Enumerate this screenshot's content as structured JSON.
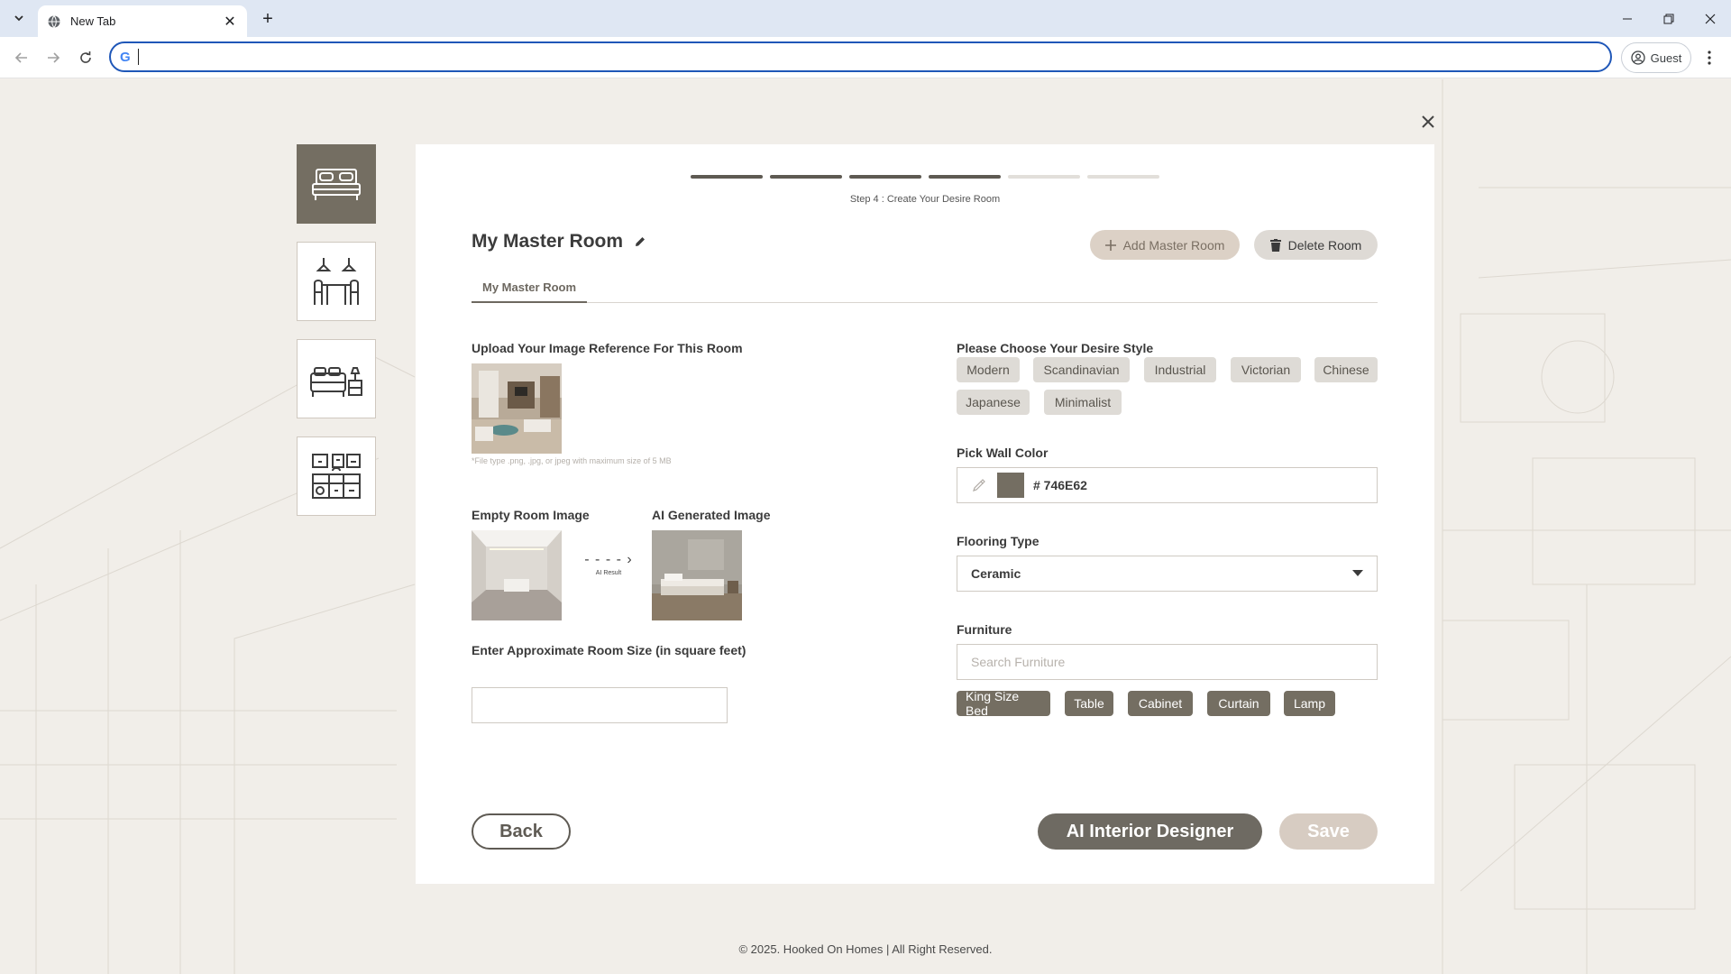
{
  "browser": {
    "tab_title": "New Tab",
    "omnibox_value": "",
    "profile_label": "Guest"
  },
  "progress": {
    "total_steps": 6,
    "completed_steps": 4,
    "step_label": "Step 4 : Create Your Desire Room"
  },
  "room": {
    "title": "My Master Room",
    "add_button": "Add Master Room",
    "delete_button": "Delete Room",
    "tabs": [
      "My Master Room"
    ]
  },
  "upload": {
    "label": "Upload Your Image Reference For This Room",
    "hint": "*File type .png, .jpg, or jpeg with maximum size of 5 MB"
  },
  "images": {
    "empty_label": "Empty Room Image",
    "ai_label": "AI Generated Image",
    "arrow_caption": "AI Result"
  },
  "size": {
    "label": "Enter Approximate Room Size (in square feet)",
    "value": ""
  },
  "style": {
    "label": "Please Choose Your Desire Style",
    "options": [
      "Modern",
      "Scandinavian",
      "Industrial",
      "Victorian",
      "Chinese",
      "Japanese",
      "Minimalist"
    ]
  },
  "wall_color": {
    "label": "Pick Wall Color",
    "hex_text": "# 746E62",
    "swatch": "#746e62"
  },
  "flooring": {
    "label": "Flooring Type",
    "selected": "Ceramic"
  },
  "furniture": {
    "label": "Furniture",
    "placeholder": "Search Furniture",
    "items": [
      "King Size Bed",
      "Table",
      "Cabinet",
      "Curtain",
      "Lamp"
    ]
  },
  "actions": {
    "back": "Back",
    "ai_designer": "AI Interior Designer",
    "save": "Save"
  },
  "footer": {
    "text": "© 2025. Hooked On Homes | All Right Reserved."
  },
  "colors": {
    "accent": "#746e62",
    "add_button_bg": "#dcd1c6",
    "save_bg": "#d7ccc2"
  },
  "room_types": [
    {
      "icon": "bedroom-icon",
      "active": true
    },
    {
      "icon": "dining-room-icon",
      "active": false
    },
    {
      "icon": "guest-bedroom-icon",
      "active": false
    },
    {
      "icon": "kitchen-icon",
      "active": false
    }
  ]
}
